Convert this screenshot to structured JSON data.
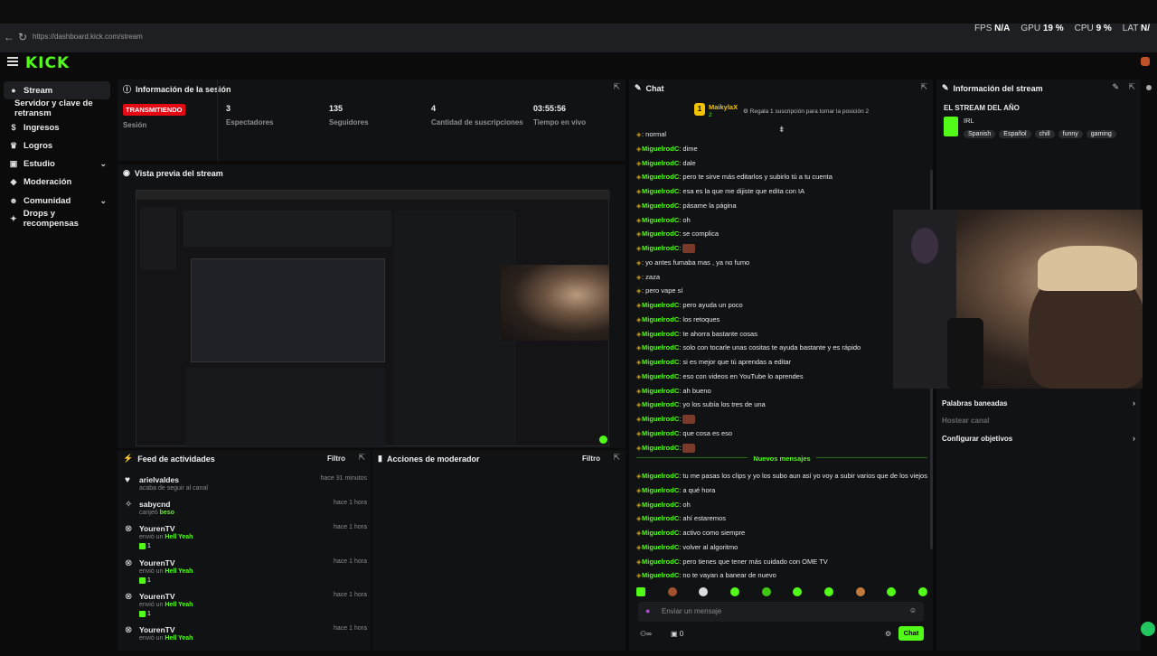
{
  "browser": {
    "url": "https://dashboard.kick.com/stream",
    "hud": {
      "fps_label": "FPS",
      "fps_val": "N/A",
      "gpu_label": "GPU",
      "gpu_val": "19 %",
      "cpu_label": "CPU",
      "cpu_val": "9 %",
      "lat_label": "LAT",
      "lat_val": "N/"
    }
  },
  "app": {
    "logo": "KICK"
  },
  "sidebar": {
    "items": [
      {
        "label": "Stream"
      },
      {
        "label": "Servidor y clave de retransm"
      },
      {
        "label": "Ingresos"
      },
      {
        "label": "Logros"
      },
      {
        "label": "Estudio"
      },
      {
        "label": "Moderación"
      },
      {
        "label": "Comunidad"
      },
      {
        "label": "Drops y recompensas"
      }
    ]
  },
  "session": {
    "title": "Información de la sesión",
    "status_badge": "TRANSMITIENDO",
    "status_label": "Sesión",
    "stats": [
      {
        "value": "3",
        "label": "Espectadores"
      },
      {
        "value": "135",
        "label": "Seguidores"
      },
      {
        "value": "4",
        "label": "Cantidad de suscripciones"
      },
      {
        "value": "03:55:56",
        "label": "Tiempo en vivo"
      }
    ]
  },
  "preview": {
    "title": "Vista previa del stream"
  },
  "activity": {
    "title": "Feed de actividades",
    "filter": "Filtro",
    "items": [
      {
        "name": "arielvaldes",
        "sub": "acaba de seguir al canal",
        "highlight": "",
        "time": "hace 31 minutos",
        "count": ""
      },
      {
        "name": "sabycnd",
        "sub": "canjeó",
        "highlight": "beso",
        "time": "hace 1 hora",
        "count": ""
      },
      {
        "name": "YourenTV",
        "sub": "envió un",
        "highlight": "Hell Yeah",
        "time": "hace 1 hora",
        "count": "1"
      },
      {
        "name": "YourenTV",
        "sub": "envió un",
        "highlight": "Hell Yeah",
        "time": "hace 1 hora",
        "count": "1"
      },
      {
        "name": "YourenTV",
        "sub": "envió un",
        "highlight": "Hell Yeah",
        "time": "hace 1 hora",
        "count": "1"
      },
      {
        "name": "YourenTV",
        "sub": "envió un",
        "highlight": "Hell Yeah",
        "time": "hace 1 hora",
        "count": ""
      }
    ]
  },
  "mod": {
    "title": "Acciones de moderador",
    "filter": "Filtro"
  },
  "chat": {
    "title": "Chat",
    "top_user": "MaikylaX",
    "top_user_rank": "1",
    "top_user_sub": "2",
    "gift_text": "Regala 1 suscripción para tomar la posición 2",
    "messages": [
      {
        "user": "",
        "text": "normal",
        "red": true
      },
      {
        "user": "MiguelrodC",
        "text": "dime"
      },
      {
        "user": "MiguelrodC",
        "text": "dale"
      },
      {
        "user": "MiguelrodC",
        "text": "pero te sirve más editarlos y subirlo tú a tu cuenta"
      },
      {
        "user": "MiguelrodC",
        "text": "esa es la que me dijiste que edita con IA"
      },
      {
        "user": "MiguelrodC",
        "text": "pásame la página"
      },
      {
        "user": "MiguelrodC",
        "text": "oh"
      },
      {
        "user": "MiguelrodC",
        "text": "se complica"
      },
      {
        "user": "MiguelrodC",
        "text": "",
        "emote": true
      },
      {
        "user": "",
        "text": "yo antes fumaba mas , ya no fumo",
        "red": true
      },
      {
        "user": "",
        "text": "zaza",
        "red": true
      },
      {
        "user": "",
        "text": "pero vape sí",
        "red": true
      },
      {
        "user": "MiguelrodC",
        "text": "pero ayuda un poco"
      },
      {
        "user": "MiguelrodC",
        "text": "los retoques"
      },
      {
        "user": "MiguelrodC",
        "text": "te ahorra bastante cosas"
      },
      {
        "user": "MiguelrodC",
        "text": "solo con tocarle unas cositas te ayuda bastante y es rápido"
      },
      {
        "user": "MiguelrodC",
        "text": "si es mejor que tú aprendas a editar"
      },
      {
        "user": "MiguelrodC",
        "text": "eso con videos en YouTube lo aprendes"
      },
      {
        "user": "MiguelrodC",
        "text": "ah bueno"
      },
      {
        "user": "MiguelrodC",
        "text": "yo los subía los tres de una"
      },
      {
        "user": "MiguelrodC",
        "text": "",
        "emote": true
      },
      {
        "user": "MiguelrodC",
        "text": "que cosa es eso"
      },
      {
        "user": "MiguelrodC",
        "text": "",
        "emote": true
      }
    ],
    "new_messages_label": "Nuevos mensajes",
    "new_messages": [
      {
        "user": "MiguelrodC",
        "text": "tu me pasas los clips y yo los subo aun así yo voy a subir varios que de los viejos"
      },
      {
        "user": "MiguelrodC",
        "text": "a qué hora"
      },
      {
        "user": "MiguelrodC",
        "text": "oh"
      },
      {
        "user": "MiguelrodC",
        "text": "ahí estaremos"
      },
      {
        "user": "MiguelrodC",
        "text": "activo como siempre"
      },
      {
        "user": "MiguelrodC",
        "text": "volver al algoritmo"
      },
      {
        "user": "MiguelrodC",
        "text": "pero tienes que tener más cuidado con OME TV"
      },
      {
        "user": "MiguelrodC",
        "text": "no te vayan a banear de nuevo"
      }
    ],
    "input_placeholder": "Enviar un mensaje",
    "footer_left": "0",
    "send_label": "Chat"
  },
  "stream_info": {
    "title": "Información del stream",
    "stream_title": "EL STREAM DEL AÑO",
    "category": "IRL",
    "tags": [
      "Spanish",
      "Español",
      "chill",
      "funny",
      "gaming"
    ],
    "links": [
      {
        "label": "Palabras baneadas"
      },
      {
        "label": "Hostear canal"
      },
      {
        "label": "Configurar objetivos"
      }
    ]
  },
  "colors": {
    "brand": "#53fc18",
    "live": "#e50914"
  }
}
